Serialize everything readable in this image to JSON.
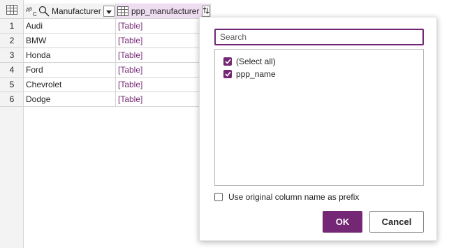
{
  "columns": [
    {
      "title": "Manufacturer",
      "type_icon": "abc-text-type-icon"
    },
    {
      "title": "ppp_manufacturer",
      "type_icon": "table-type-icon"
    }
  ],
  "rows": [
    {
      "num": "1",
      "manufacturer": "Audi",
      "ppp": "[Table]"
    },
    {
      "num": "2",
      "manufacturer": "BMW",
      "ppp": "[Table]"
    },
    {
      "num": "3",
      "manufacturer": "Honda",
      "ppp": "[Table]"
    },
    {
      "num": "4",
      "manufacturer": "Ford",
      "ppp": "[Table]"
    },
    {
      "num": "5",
      "manufacturer": "Chevrolet",
      "ppp": "[Table]"
    },
    {
      "num": "6",
      "manufacturer": "Dodge",
      "ppp": "[Table]"
    }
  ],
  "popup": {
    "search_placeholder": "Search",
    "items": [
      {
        "label": "(Select all)",
        "checked": true
      },
      {
        "label": "ppp_name",
        "checked": true
      }
    ],
    "prefix_label": "Use original column name as prefix",
    "prefix_checked": false,
    "ok_label": "OK",
    "cancel_label": "Cancel"
  },
  "colors": {
    "accent": "#742774",
    "selected_column_bg": "#eedcf1",
    "header_bg": "#f3f3f3"
  }
}
